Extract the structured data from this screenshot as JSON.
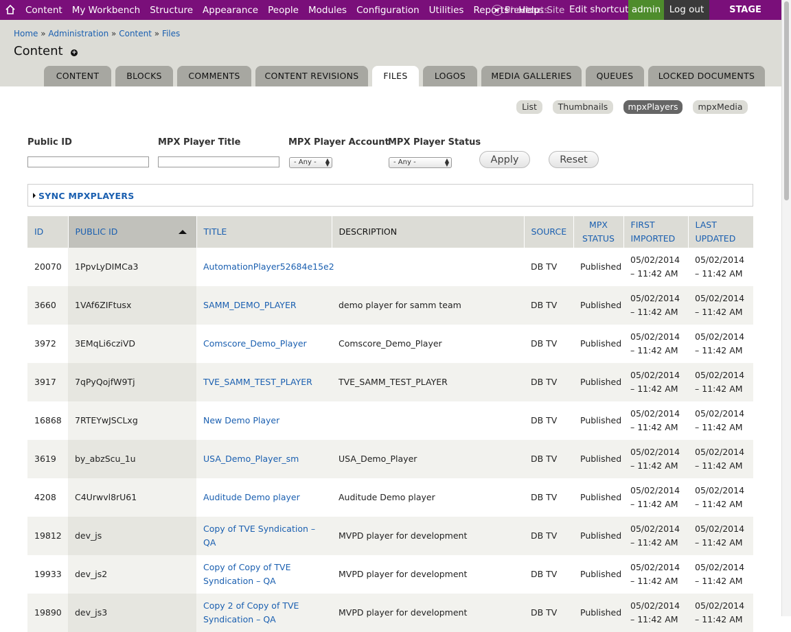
{
  "toolbar": {
    "menu": [
      "Content",
      "My Workbench",
      "Structure",
      "Appearance",
      "People",
      "Modules",
      "Configuration",
      "Utilities",
      "Reports",
      "Help"
    ],
    "shortcuts": "Shortcuts",
    "previous_site": "Previous Site",
    "edit_shortcuts": "Edit shortcuts",
    "user": "admin",
    "logout": "Log out",
    "server": "STAGE SERVER",
    "colors": {
      "bar": "#7a0f7a",
      "admin": "#4e8c2c",
      "logout": "#3a3a3a"
    }
  },
  "breadcrumb": [
    "Home",
    "Administration",
    "Content",
    "Files"
  ],
  "page_title": "Content",
  "tabs": [
    "CONTENT",
    "BLOCKS",
    "COMMENTS",
    "CONTENT REVISIONS",
    "FILES",
    "LOGOS",
    "MEDIA GALLERIES",
    "QUEUES",
    "LOCKED DOCUMENTS"
  ],
  "active_tab": "FILES",
  "views": [
    "List",
    "Thumbnails",
    "mpxPlayers",
    "mpxMedia"
  ],
  "active_view": "mpxPlayers",
  "filters": {
    "public_id": {
      "label": "Public ID",
      "value": ""
    },
    "player_title": {
      "label": "MPX Player Title",
      "value": ""
    },
    "player_account": {
      "label": "MPX Player Account",
      "selected": "- Any -"
    },
    "player_status": {
      "label": "MPX Player Status",
      "selected": "- Any -"
    },
    "apply": "Apply",
    "reset": "Reset"
  },
  "sync_label": "SYNC MPXPLAYERS",
  "table": {
    "headers": {
      "id": "ID",
      "public_id": "PUBLIC ID",
      "title": "TITLE",
      "description": "DESCRIPTION",
      "source": "SOURCE",
      "mpx_status_1": "MPX",
      "mpx_status_2": "STATUS",
      "first_imported_1": "FIRST",
      "first_imported_2": "IMPORTED",
      "last_updated_1": "LAST",
      "last_updated_2": "UPDATED"
    },
    "rows": [
      {
        "id": "20070",
        "public_id": "1PpvLyDIMCa3",
        "title_1": "AutomationPlayer52684e15e2",
        "title_2": "",
        "description": "",
        "source": "DB TV",
        "status": "Published",
        "first_date": "05/02/2014",
        "first_time": "– 11:42 AM",
        "last_date": "05/02/2014",
        "last_time": "– 11:42 AM"
      },
      {
        "id": "3660",
        "public_id": "1VAf6ZIFtusx",
        "title_1": "SAMM_DEMO_PLAYER",
        "title_2": "",
        "description": "demo player for samm team",
        "source": "DB TV",
        "status": "Published",
        "first_date": "05/02/2014",
        "first_time": "– 11:42 AM",
        "last_date": "05/02/2014",
        "last_time": "– 11:42 AM"
      },
      {
        "id": "3972",
        "public_id": "3EMqLi6cziVD",
        "title_1": "Comscore_Demo_Player",
        "title_2": "",
        "description": "Comscore_Demo_Player",
        "source": "DB TV",
        "status": "Published",
        "first_date": "05/02/2014",
        "first_time": "– 11:42 AM",
        "last_date": "05/02/2014",
        "last_time": "– 11:42 AM"
      },
      {
        "id": "3917",
        "public_id": "7qPyQojfW9Tj",
        "title_1": "TVE_SAMM_TEST_PLAYER",
        "title_2": "",
        "description": "TVE_SAMM_TEST_PLAYER",
        "source": "DB TV",
        "status": "Published",
        "first_date": "05/02/2014",
        "first_time": "– 11:42 AM",
        "last_date": "05/02/2014",
        "last_time": "– 11:42 AM"
      },
      {
        "id": "16868",
        "public_id": "7RTEYwJSCLxg",
        "title_1": "New Demo Player",
        "title_2": "",
        "description": "",
        "source": "DB TV",
        "status": "Published",
        "first_date": "05/02/2014",
        "first_time": "– 11:42 AM",
        "last_date": "05/02/2014",
        "last_time": "– 11:42 AM"
      },
      {
        "id": "3619",
        "public_id": "by_abzScu_1u",
        "title_1": "USA_Demo_Player_sm",
        "title_2": "",
        "description": "USA_Demo_Player",
        "source": "DB TV",
        "status": "Published",
        "first_date": "05/02/2014",
        "first_time": "– 11:42 AM",
        "last_date": "05/02/2014",
        "last_time": "– 11:42 AM"
      },
      {
        "id": "4208",
        "public_id": "C4Urwvl8rU61",
        "title_1": "Auditude Demo player",
        "title_2": "",
        "description": "Auditude Demo player",
        "source": "DB TV",
        "status": "Published",
        "first_date": "05/02/2014",
        "first_time": "– 11:42 AM",
        "last_date": "05/02/2014",
        "last_time": "– 11:42 AM"
      },
      {
        "id": "19812",
        "public_id": "dev_js",
        "title_1": "Copy of TVE Syndication – QA",
        "title_2": "",
        "description": "MVPD player for development",
        "source": "DB TV",
        "status": "Published",
        "first_date": "05/02/2014",
        "first_time": "– 11:42 AM",
        "last_date": "05/02/2014",
        "last_time": "– 11:42 AM"
      },
      {
        "id": "19933",
        "public_id": "dev_js2",
        "title_1": "Copy of Copy of TVE",
        "title_2": "Syndication – QA",
        "description": "MVPD player for development",
        "source": "DB TV",
        "status": "Published",
        "first_date": "05/02/2014",
        "first_time": "– 11:42 AM",
        "last_date": "05/02/2014",
        "last_time": "– 11:42 AM"
      },
      {
        "id": "19890",
        "public_id": "dev_js3",
        "title_1": "Copy 2 of Copy of TVE",
        "title_2": "Syndication – QA",
        "description": "MVPD player for development",
        "source": "DB TV",
        "status": "Published",
        "first_date": "05/02/2014",
        "first_time": "– 11:42 AM",
        "last_date": "05/02/2014",
        "last_time": "– 11:42 AM"
      }
    ]
  }
}
